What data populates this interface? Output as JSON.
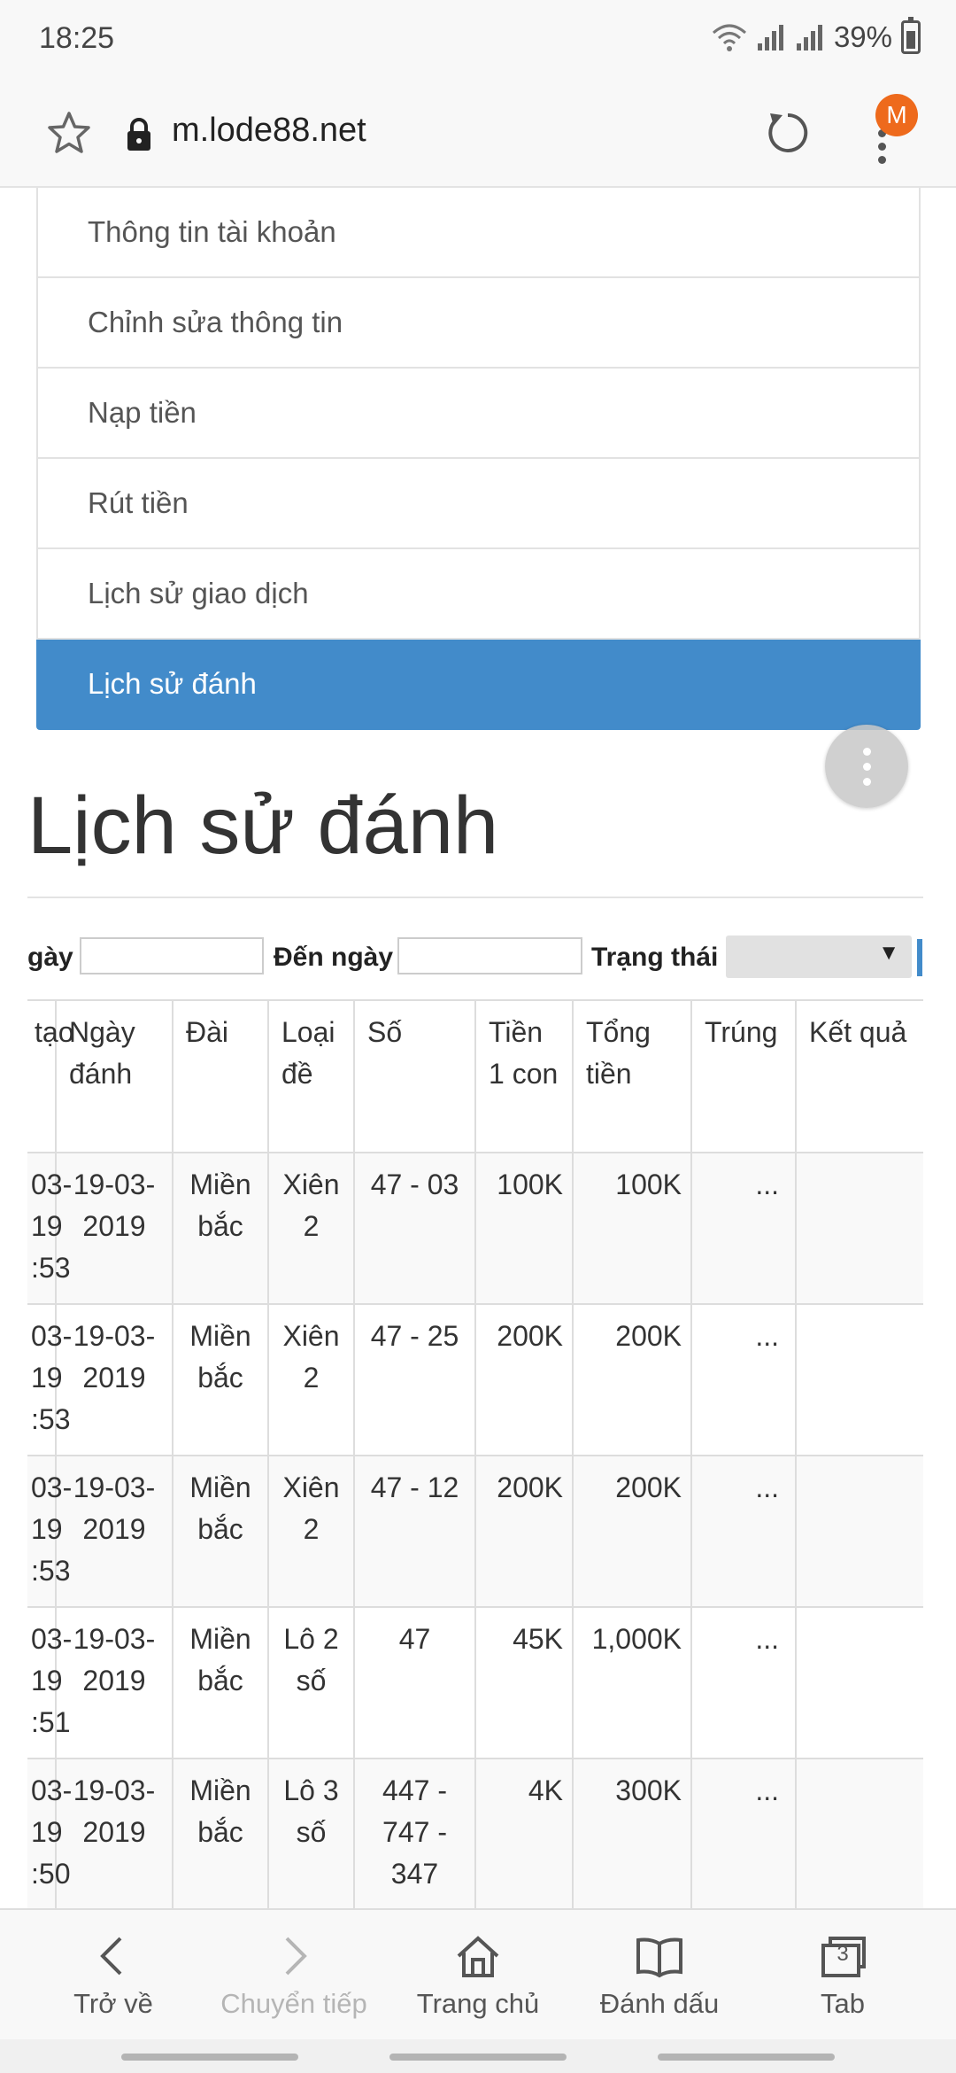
{
  "status_bar": {
    "time": "18:25",
    "battery": "39%"
  },
  "browser": {
    "url": "m.lode88.net",
    "avatar_letter": "M"
  },
  "account_menu": {
    "items": [
      {
        "label": "Thông tin tài khoản"
      },
      {
        "label": "Chỉnh sửa thông tin"
      },
      {
        "label": "Nạp tiền"
      },
      {
        "label": "Rút tiền"
      },
      {
        "label": "Lịch sử giao dịch"
      },
      {
        "label": "Lịch sử đánh",
        "active": true
      }
    ]
  },
  "page": {
    "title": "Lịch sử đánh"
  },
  "filters": {
    "from_label": "gày",
    "to_label": "Đến ngày",
    "status_label": "Trạng thái",
    "from_value": "",
    "to_value": "",
    "status_value": ""
  },
  "table": {
    "headers": [
      "tạo",
      "Ngày đánh",
      "Đài",
      "Loại đề",
      "Số",
      "Tiền 1 con",
      "Tổng tiền",
      "Trúng",
      "Kết quả"
    ],
    "rows": [
      {
        "created": "03-19 :53",
        "date": "19-03-2019",
        "station": "Miền bắc",
        "type": "Xiên 2",
        "number": "47 - 03",
        "per_unit": "100K",
        "total": "100K",
        "won": "...",
        "result": ""
      },
      {
        "created": "03-19 :53",
        "date": "19-03-2019",
        "station": "Miền bắc",
        "type": "Xiên 2",
        "number": "47 - 25",
        "per_unit": "200K",
        "total": "200K",
        "won": "...",
        "result": ""
      },
      {
        "created": "03-19 :53",
        "date": "19-03-2019",
        "station": "Miền bắc",
        "type": "Xiên 2",
        "number": "47 - 12",
        "per_unit": "200K",
        "total": "200K",
        "won": "...",
        "result": ""
      },
      {
        "created": "03-19 :51",
        "date": "19-03-2019",
        "station": "Miền bắc",
        "type": "Lô 2 số",
        "number": "47",
        "per_unit": "45K",
        "total": "1,000K",
        "won": "...",
        "result": ""
      },
      {
        "created": "03-19 :50",
        "date": "19-03-2019",
        "station": "Miền bắc",
        "type": "Lô 3 số",
        "number": "447 - 747 - 347",
        "per_unit": "4K",
        "total": "300K",
        "won": "...",
        "result": ""
      }
    ]
  },
  "bottom_nav": {
    "back": "Trở về",
    "forward": "Chuyển tiếp",
    "home": "Trang chủ",
    "bookmarks": "Đánh dấu",
    "tabs": "Tab",
    "tab_count": "3"
  },
  "colors": {
    "accent": "#428bca",
    "avatar": "#ee6a1c"
  }
}
